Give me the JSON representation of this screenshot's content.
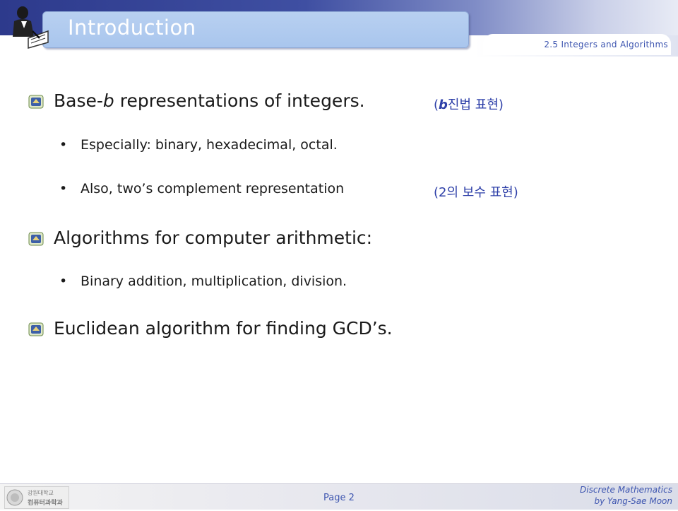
{
  "header": {
    "title": "Introduction",
    "subtitle": "2.5 Integers and Algorithms"
  },
  "bullets": [
    {
      "text_prefix": "Base-",
      "text_var": "b",
      "text_suffix": " representations of integers.",
      "note_open": "(",
      "note_var": "b",
      "note_text": "진법 표현)"
    },
    {
      "sub": "Especially: binary, hexadecimal, octal."
    },
    {
      "sub": "Also, two’s complement representation",
      "note": "(2의 보수 표현)"
    },
    {
      "text": "Algorithms for computer arithmetic:"
    },
    {
      "sub": "Binary addition, multiplication, division."
    },
    {
      "text": "Euclidean algorithm for finding GCD’s."
    }
  ],
  "bullet_glyph": "•",
  "footer": {
    "page": "Page 2",
    "course": "Discrete Mathematics",
    "author": "by Yang-Sae Moon",
    "logo_text_1": "강원대학교",
    "logo_text_2": "컴퓨터과학과"
  },
  "colors": {
    "accent": "#3e56b0",
    "header_dark": "#2d3a8c",
    "title_box": "#a9c6ee"
  },
  "icons": {
    "header_logo": "person-writing-icon",
    "bullet_icon": "university-emblem-icon"
  }
}
